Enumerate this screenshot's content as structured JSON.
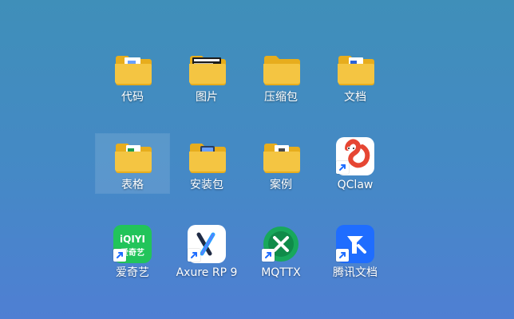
{
  "desktop": {
    "icons": [
      {
        "label": "代码",
        "type": "folder",
        "badge": "code"
      },
      {
        "label": "图片",
        "type": "folder",
        "badge": "image"
      },
      {
        "label": "压缩包",
        "type": "folder",
        "badge": "none"
      },
      {
        "label": "文档",
        "type": "folder",
        "badge": "word"
      },
      {
        "label": "表格",
        "type": "folder",
        "badge": "excel",
        "selected": true
      },
      {
        "label": "安装包",
        "type": "folder",
        "badge": "installer"
      },
      {
        "label": "案例",
        "type": "folder",
        "badge": "cases"
      },
      {
        "label": "QClaw",
        "type": "app",
        "icon": "qclaw-icon"
      },
      {
        "label": "爱奇艺",
        "type": "app",
        "icon": "iqiyi-icon",
        "brand_text": "iQIYI",
        "brand_subtext": "爱奇艺"
      },
      {
        "label": "Axure RP 9",
        "type": "app",
        "icon": "axure-icon"
      },
      {
        "label": "MQTTX",
        "type": "app",
        "icon": "mqttx-icon"
      },
      {
        "label": "腾讯文档",
        "type": "app",
        "icon": "tencent-docs-icon"
      }
    ]
  },
  "colors": {
    "folder": "#f4c542",
    "folder_dark": "#e7ad1d",
    "iqiyi": "#22c45a",
    "mqttx": "#18a85b",
    "tencent_docs": "#1f6dff",
    "qclaw": "#e64633"
  }
}
